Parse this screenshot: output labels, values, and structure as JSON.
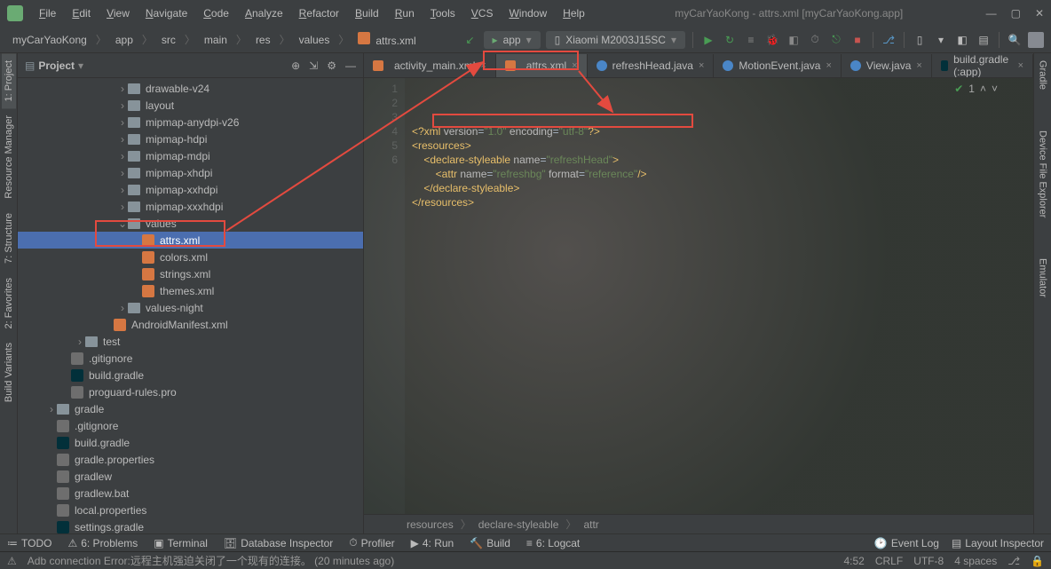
{
  "window": {
    "title": "myCarYaoKong - attrs.xml [myCarYaoKong.app]"
  },
  "menu": [
    "File",
    "Edit",
    "View",
    "Navigate",
    "Code",
    "Analyze",
    "Refactor",
    "Build",
    "Run",
    "Tools",
    "VCS",
    "Window",
    "Help"
  ],
  "breadcrumb": [
    "myCarYaoKong",
    "app",
    "src",
    "main",
    "res",
    "values",
    "attrs.xml"
  ],
  "run_config": "app",
  "device": "Xiaomi M2003J15SC",
  "left_tabs": [
    "1: Project",
    "Resource Manager",
    "7: Structure",
    "2: Favorites",
    "Build Variants"
  ],
  "right_tabs": [
    "Gradle",
    "Device File Explorer",
    "Emulator"
  ],
  "project_panel_title": "Project",
  "tree": [
    {
      "indent": 7,
      "arrow": "›",
      "type": "folder",
      "label": "drawable-v24"
    },
    {
      "indent": 7,
      "arrow": "›",
      "type": "folder",
      "label": "layout"
    },
    {
      "indent": 7,
      "arrow": "›",
      "type": "folder",
      "label": "mipmap-anydpi-v26"
    },
    {
      "indent": 7,
      "arrow": "›",
      "type": "folder",
      "label": "mipmap-hdpi"
    },
    {
      "indent": 7,
      "arrow": "›",
      "type": "folder",
      "label": "mipmap-mdpi"
    },
    {
      "indent": 7,
      "arrow": "›",
      "type": "folder",
      "label": "mipmap-xhdpi"
    },
    {
      "indent": 7,
      "arrow": "›",
      "type": "folder",
      "label": "mipmap-xxhdpi"
    },
    {
      "indent": 7,
      "arrow": "›",
      "type": "folder",
      "label": "mipmap-xxxhdpi"
    },
    {
      "indent": 7,
      "arrow": "⌄",
      "type": "folder",
      "label": "values"
    },
    {
      "indent": 8,
      "arrow": "",
      "type": "xml",
      "label": "attrs.xml",
      "selected": true
    },
    {
      "indent": 8,
      "arrow": "",
      "type": "xml",
      "label": "colors.xml"
    },
    {
      "indent": 8,
      "arrow": "",
      "type": "xml",
      "label": "strings.xml"
    },
    {
      "indent": 8,
      "arrow": "",
      "type": "xml",
      "label": "themes.xml"
    },
    {
      "indent": 7,
      "arrow": "›",
      "type": "folder",
      "label": "values-night"
    },
    {
      "indent": 6,
      "arrow": "",
      "type": "xml",
      "label": "AndroidManifest.xml"
    },
    {
      "indent": 4,
      "arrow": "›",
      "type": "folder",
      "label": "test"
    },
    {
      "indent": 3,
      "arrow": "",
      "type": "file",
      "label": ".gitignore"
    },
    {
      "indent": 3,
      "arrow": "",
      "type": "gradle",
      "label": "build.gradle"
    },
    {
      "indent": 3,
      "arrow": "",
      "type": "file",
      "label": "proguard-rules.pro"
    },
    {
      "indent": 2,
      "arrow": "›",
      "type": "folder",
      "label": "gradle"
    },
    {
      "indent": 2,
      "arrow": "",
      "type": "file",
      "label": ".gitignore"
    },
    {
      "indent": 2,
      "arrow": "",
      "type": "gradle",
      "label": "build.gradle"
    },
    {
      "indent": 2,
      "arrow": "",
      "type": "file",
      "label": "gradle.properties"
    },
    {
      "indent": 2,
      "arrow": "",
      "type": "file",
      "label": "gradlew"
    },
    {
      "indent": 2,
      "arrow": "",
      "type": "file",
      "label": "gradlew.bat"
    },
    {
      "indent": 2,
      "arrow": "",
      "type": "file",
      "label": "local.properties"
    },
    {
      "indent": 2,
      "arrow": "",
      "type": "gradle",
      "label": "settings.gradle"
    }
  ],
  "editor_tabs": [
    {
      "label": "activity_main.xml",
      "icon": "xml",
      "active": false
    },
    {
      "label": "attrs.xml",
      "icon": "xml",
      "active": true
    },
    {
      "label": "refreshHead.java",
      "icon": "java",
      "active": false
    },
    {
      "label": "MotionEvent.java",
      "icon": "java",
      "active": false
    },
    {
      "label": "View.java",
      "icon": "java",
      "active": false
    },
    {
      "label": "build.gradle (:app)",
      "icon": "gradle",
      "active": false
    }
  ],
  "code_lines": [
    "1",
    "2",
    "3",
    "4",
    "5",
    "6"
  ],
  "code": {
    "l1": {
      "pre": "<?xml ",
      "attr1": "version",
      "val1": "\"1.0\"",
      "attr2": " encoding",
      "val2": "\"utf-8\"",
      "post": "?>"
    },
    "l2": "<resources>",
    "l3": {
      "pre": "    <declare-styleable ",
      "attr": "name",
      "val": "\"refreshHead\"",
      "post": ">"
    },
    "l4": {
      "pre": "        <attr ",
      "attr1": "name",
      "val1": "\"refreshbg\"",
      "attr2": " format",
      "val2": "\"reference\"",
      "post": "/>"
    },
    "l5": "    </declare-styleable>",
    "l6": "</resources>"
  },
  "inspection": {
    "count": "1"
  },
  "editor_breadcrumb": [
    "resources",
    "declare-styleable",
    "attr"
  ],
  "bottom_tabs": [
    "TODO",
    "6: Problems",
    "Terminal",
    "Database Inspector",
    "Profiler",
    "4: Run",
    "Build",
    "6: Logcat"
  ],
  "bottom_right": [
    "Event Log",
    "Layout Inspector"
  ],
  "status": {
    "msg": "Adb connection Error:远程主机强迫关闭了一个现有的连接。 (20 minutes ago)",
    "pos": "4:52",
    "eol": "CRLF",
    "enc": "UTF-8",
    "spaces": "4 spaces"
  }
}
